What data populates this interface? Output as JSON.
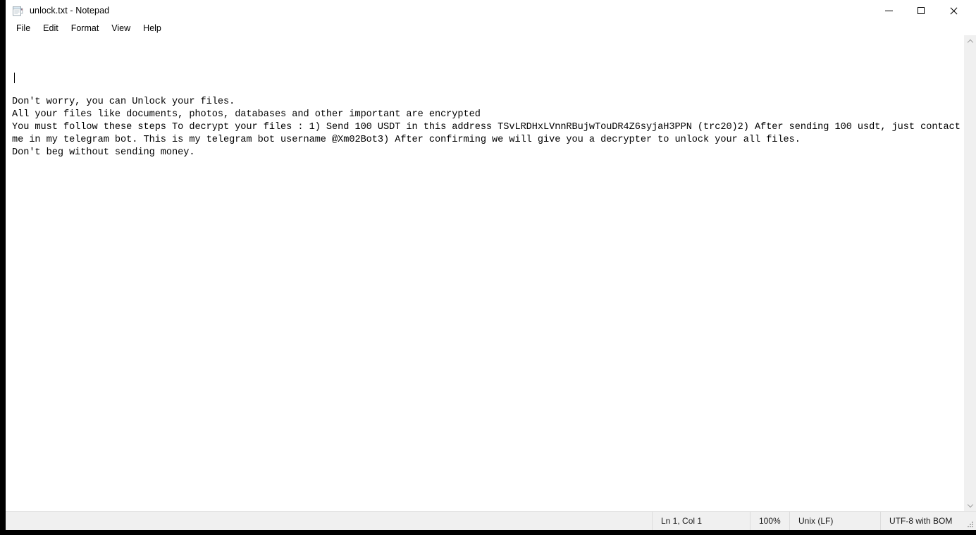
{
  "window": {
    "title": "unlock.txt - Notepad",
    "icon": "notepad-icon",
    "controls": {
      "minimize": "minimize",
      "maximize": "maximize",
      "close": "close"
    }
  },
  "menu": {
    "items": [
      {
        "label": "File"
      },
      {
        "label": "Edit"
      },
      {
        "label": "Format"
      },
      {
        "label": "View"
      },
      {
        "label": "Help"
      }
    ]
  },
  "document": {
    "filename": "unlock.txt",
    "lines": [
      "",
      "Don't worry, you can Unlock your files.",
      "All your files like documents, photos, databases and other important are encrypted",
      "You must follow these steps To decrypt your files : 1) Send 100 USDT in this address TSvLRDHxLVnnRBujwTouDR4Z6syjaH3PPN (trc20)2) After sending 100 usdt, just contact",
      "me in my telegram bot. This is my telegram bot username @Xm02Bot3) After confirming we will give you a decrypter to unlock your all files.",
      "Don't beg without sending money."
    ],
    "text": "\nDon't worry, you can Unlock your files.\nAll your files like documents, photos, databases and other important are encrypted\nYou must follow these steps To decrypt your files : 1) Send 100 USDT in this address TSvLRDHxLVnnRBujwTouDR4Z6syjaH3PPN (trc20)2) After sending 100 usdt, just contact\nme in my telegram bot. This is my telegram bot username @Xm02Bot3) After confirming we will give you a decrypter to unlock your all files.\nDon't beg without sending money.",
    "wallet_address": "TSvLRDHxLVnnRBujwTouDR4Z6syjaH3PPN",
    "wallet_network": "trc20",
    "ransom_amount": "100 USDT",
    "telegram_bot": "@Xm02Bot"
  },
  "scrollbar": {
    "up_arrow": "chevron-up",
    "down_arrow": "chevron-down"
  },
  "status_bar": {
    "cursor_position": "Ln 1, Col 1",
    "zoom": "100%",
    "line_ending": "Unix (LF)",
    "encoding": "UTF-8 with BOM"
  },
  "colors": {
    "window_background": "#ffffff",
    "status_background": "#f0f0f0",
    "frame": "#000000",
    "text": "#000000",
    "scrollbar_track": "#f0f0f0"
  }
}
